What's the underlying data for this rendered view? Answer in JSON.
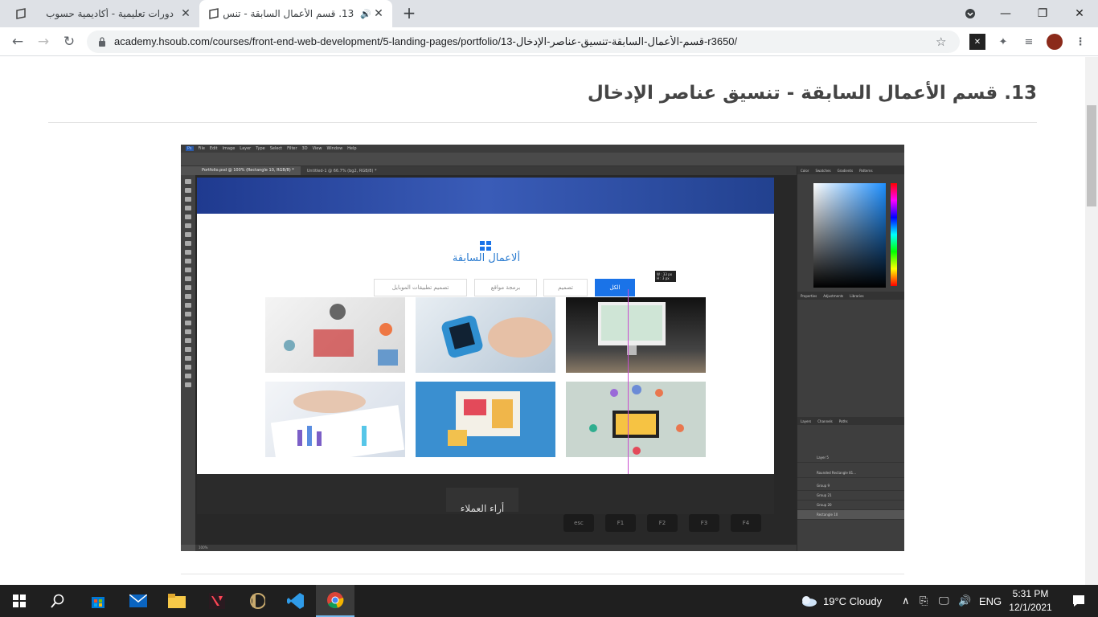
{
  "browser": {
    "tabs": [
      {
        "title": "دورات تعليمية - أكاديمية حسوب",
        "active": false
      },
      {
        "title": "13. قسم الأعمال السابقة - تنس",
        "active": true
      }
    ],
    "new_tab": "+",
    "url": "academy.hsoub.com/courses/front-end-web-development/5-landing-pages/portfolio/13-قسم-الأعمال-السابقة-تنسيق-عناصر-الإدخال-r3650/",
    "window_controls": [
      "⌄",
      "—",
      "❐",
      "✕"
    ]
  },
  "page": {
    "lesson_title": "13. قسم الأعمال السابقة - تنسيق عناصر الإدخال"
  },
  "video": {
    "ps_menu": [
      "File",
      "Edit",
      "Image",
      "Layer",
      "Type",
      "Select",
      "Filter",
      "3D",
      "View",
      "Window",
      "Help"
    ],
    "ps_tabs": [
      "Portfolio.psd @ 100% (Rectangle 10, RGB/8) *",
      "Untitled-1 @ 66.7% (bg2, RGB/8) *"
    ],
    "portfolio_heading": "ألاعمال السابقة",
    "filters": [
      "الكل",
      "تصميم",
      "برمجة مواقع",
      "تصميم تطبيقات الموبايل"
    ],
    "measure": "W : 33 px\nH : 3 px",
    "reviews_heading": "أراء العملاء",
    "keys": [
      "esc",
      "F1",
      "F2",
      "F3",
      "F4"
    ],
    "status": "100%",
    "right_panel_tabs": [
      "Color",
      "Swatches",
      "Gradients",
      "Patterns"
    ],
    "props_tabs": [
      "Properties",
      "Adjustments",
      "Libraries"
    ],
    "layers_tabs": [
      "Layers",
      "Channels",
      "Paths"
    ],
    "layers": [
      "Layer 5",
      "Rounded Rectangle 81...",
      "Group 9",
      "Group 21",
      "Group 20",
      "Rectangle 10"
    ]
  },
  "taskbar": {
    "weather": "19°C  Cloudy",
    "language": "ENG",
    "time": "5:31 PM",
    "date": "12/1/2021"
  },
  "colors": {
    "accent": "#1a73e8",
    "taskbar": "#1f1f1f"
  }
}
